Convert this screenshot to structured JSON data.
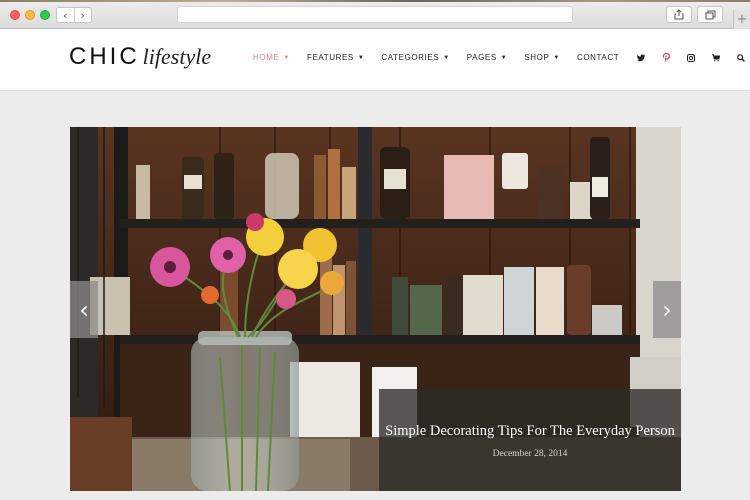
{
  "browser": {
    "back_glyph": "‹",
    "forward_glyph": "›",
    "new_tab_glyph": "+"
  },
  "site": {
    "logo_main": "CHIC",
    "logo_script": "lifestyle"
  },
  "nav": {
    "items": [
      {
        "label": "HOME",
        "has_dropdown": true,
        "active": true
      },
      {
        "label": "FEATURES",
        "has_dropdown": true
      },
      {
        "label": "CATEGORIES",
        "has_dropdown": true
      },
      {
        "label": "PAGES",
        "has_dropdown": true
      },
      {
        "label": "SHOP",
        "has_dropdown": true
      },
      {
        "label": "CONTACT",
        "has_dropdown": false
      }
    ],
    "caret_glyph": "▼",
    "icons": [
      "twitter-icon",
      "pinterest-icon",
      "instagram-icon",
      "cart-icon",
      "search-icon"
    ],
    "active_color": "#e57b88"
  },
  "slider": {
    "prev_glyph": "‹",
    "next_glyph": "›",
    "slide": {
      "title": "Simple Decorating Tips For The Everyday Person",
      "date": "December 28, 2014"
    }
  }
}
